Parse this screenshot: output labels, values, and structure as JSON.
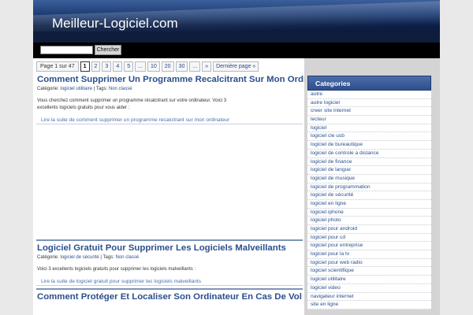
{
  "header": {
    "site_title": "Meilleur-Logiciel.com"
  },
  "search": {
    "placeholder": "",
    "button_label": "Chercher"
  },
  "pagination": {
    "info": "Page 1 sur 47",
    "pages": [
      "1",
      "2",
      "3",
      "4",
      "5",
      "...",
      "10",
      "20",
      "30",
      "...",
      "»",
      "Dernière page »"
    ]
  },
  "posts": [
    {
      "title": "Comment Supprimer Un Programme Recalcitrant Sur Mon Ordinateur",
      "meta_prefix": "Catégorie:",
      "category": "logiciel utilitaire",
      "tags_prefix": "| Tags:",
      "tag": "Non classé",
      "excerpt": "Vous cherchez comment supprimer un programme récalcitrant sur votre ordinateur. Voici 3 excellents logiciels gratuits pour vous aider :",
      "more": "Lire la suite de comment supprimer un programme recalcitrant sur mon ordinateur"
    },
    {
      "title": "Logiciel Gratuit Pour Supprimer Les Logiciels Malveillants",
      "meta_prefix": "Catégorie:",
      "category": "logiciel de sécurité",
      "tags_prefix": "| Tags:",
      "tag": "Non classé",
      "excerpt": "Voici 3 excellents logiciels gratuits pour supprimer les logiciels malveillants :",
      "more": "Lire la suite de logiciel gratuit pour supprimer les logiciels malveillants"
    },
    {
      "title": "Comment Protéger Et Localiser Son Ordinateur En Cas De Vol"
    }
  ],
  "sidebar": {
    "categories_title": "Categories",
    "categories": [
      "autre",
      "autre logiciel",
      "creer site internet",
      "lecteur",
      "logiciel",
      "logiciel cle usb",
      "logiciel de bureautique",
      "logiciel de controle a distance",
      "logiciel de finance",
      "logiciel de langue",
      "logiciel de musique",
      "logiciel de programmation",
      "logiciel de sécurité",
      "logiciel en ligne",
      "logiciel iphone",
      "logiciel photo",
      "logiciel pour android",
      "logiciel pour cd",
      "logiciel pour entreprise",
      "logiciel pour la tv",
      "logiciel pour web radio",
      "logiciel scientifique",
      "logiciel utilitaire",
      "logiciel video",
      "navigateur internet",
      "site en ligne"
    ]
  }
}
